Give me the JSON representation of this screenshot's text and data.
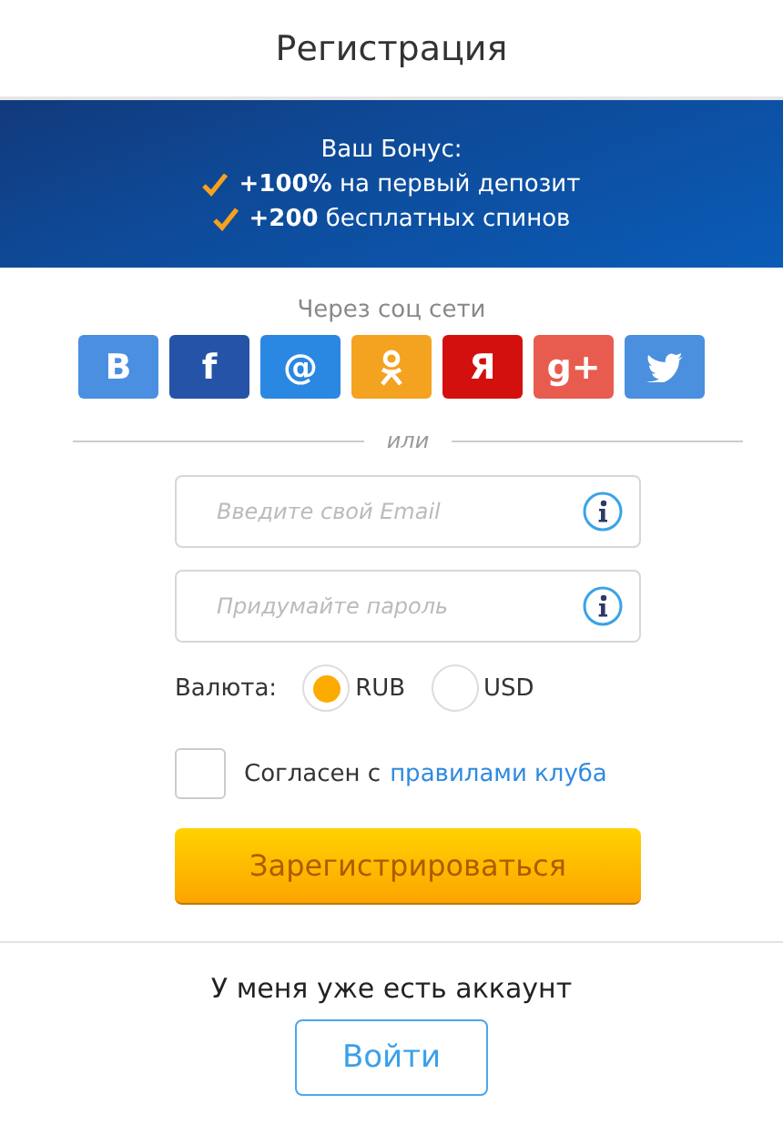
{
  "header": {
    "title": "Регистрация"
  },
  "bonus": {
    "title": "Ваш Бонус:",
    "items": [
      "**+100%** на первый депозит",
      "**+200** бесплатных спинов"
    ]
  },
  "social": {
    "label": "Через соц сети",
    "buttons": [
      {
        "kind": "glyph",
        "glyph": "B",
        "color": "#4a8fe0"
      },
      {
        "kind": "glyph",
        "glyph": "f",
        "color": "#2553a8"
      },
      {
        "kind": "glyph",
        "glyph": "@",
        "color": "#2a87e2"
      },
      {
        "kind": "ok",
        "color": "#f4a320"
      },
      {
        "kind": "glyph",
        "glyph": "Я",
        "color": "#d4100f"
      },
      {
        "kind": "glyph",
        "glyph": "g+",
        "color": "#e85c4f"
      },
      {
        "kind": "bird",
        "color": "#4a90df"
      }
    ]
  },
  "divider": "или",
  "fields": [
    {
      "placeholder": "Введите свой Email"
    },
    {
      "placeholder": "Придумайте пароль"
    }
  ],
  "currency": {
    "label": "Валюта:",
    "options": [
      {
        "label": "RUB",
        "selected": true
      },
      {
        "label": "USD",
        "selected": false
      }
    ]
  },
  "agree": {
    "checked": false,
    "text": "Согласен с",
    "link": "правилами клуба"
  },
  "register": "Зарегистрироваться",
  "login": {
    "text": "У меня уже есть аккаунт",
    "button": "Войти"
  }
}
